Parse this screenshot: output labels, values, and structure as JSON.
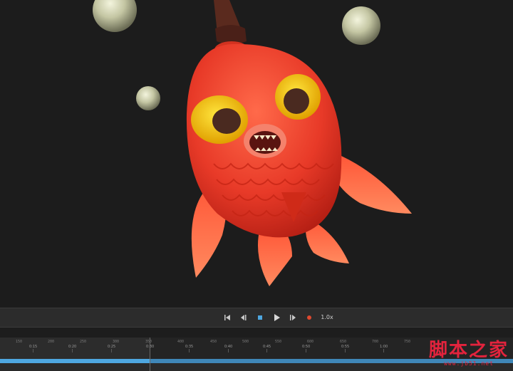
{
  "transport": {
    "speed_label": "1.0x",
    "buttons": [
      "go-to-start",
      "step-back",
      "stop",
      "play",
      "step-forward",
      "record"
    ]
  },
  "timeline": {
    "frame_numbers": [
      "150",
      "200",
      "250",
      "300",
      "350",
      "400",
      "450",
      "500",
      "550",
      "600",
      "650",
      "700",
      "750"
    ],
    "time_labels": [
      "0:15",
      "0:20",
      "0:25",
      "0:30",
      "0:35",
      "0:40",
      "0:45",
      "0:50",
      "0:55",
      "1:00"
    ],
    "current_time": "0:30"
  },
  "watermark": {
    "text": "脚本之家",
    "url": "www.jb51.net"
  },
  "colors": {
    "background": "#1c1c1c",
    "fish_body": "#e83a28",
    "eye_yellow": "#f2c200",
    "bubble": "#c9cba9",
    "track_blue": "#4ea7e0",
    "watermark_red": "#e3233d"
  }
}
